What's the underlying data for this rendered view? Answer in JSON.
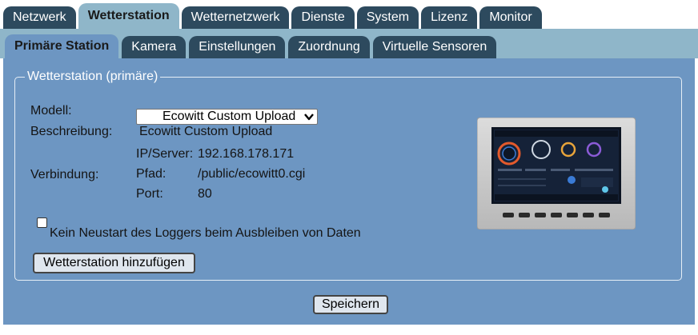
{
  "main_tabs": [
    {
      "label": "Netzwerk"
    },
    {
      "label": "Wetterstation",
      "active": true
    },
    {
      "label": "Wetternetzwerk"
    },
    {
      "label": "Dienste"
    },
    {
      "label": "System"
    },
    {
      "label": "Lizenz"
    },
    {
      "label": "Monitor"
    }
  ],
  "sub_tabs": [
    {
      "label": "Primäre Station",
      "active": true
    },
    {
      "label": "Kamera"
    },
    {
      "label": "Einstellungen"
    },
    {
      "label": "Zuordnung"
    },
    {
      "label": "Virtuelle Sensoren"
    }
  ],
  "station": {
    "legend": "Wetterstation (primäre)",
    "model_label": "Modell:",
    "model_value": "Ecowitt Custom Upload",
    "description_label": "Beschreibung:",
    "description_value": "Ecowitt Custom Upload",
    "connection_label": "Verbindung:",
    "ip_label": "IP/Server:",
    "ip_value": "192.168.178.171",
    "path_label": "Pfad:",
    "path_value": "/public/ecowitt0.cgi",
    "port_label": "Port:",
    "port_value": "80",
    "no_restart_label": "Kein Neustart des Loggers beim Ausbleiben von Daten",
    "no_restart_checked": false,
    "add_button": "Wetterstation hinzufügen"
  },
  "save_button": "Speichern",
  "icons": {
    "dropdown": "chevron-down-icon",
    "device": "weather-station-display-image"
  },
  "colors": {
    "tab_dark": "#2d4a5e",
    "tab_strip": "#8fb6c9",
    "panel": "#6d96c2"
  }
}
